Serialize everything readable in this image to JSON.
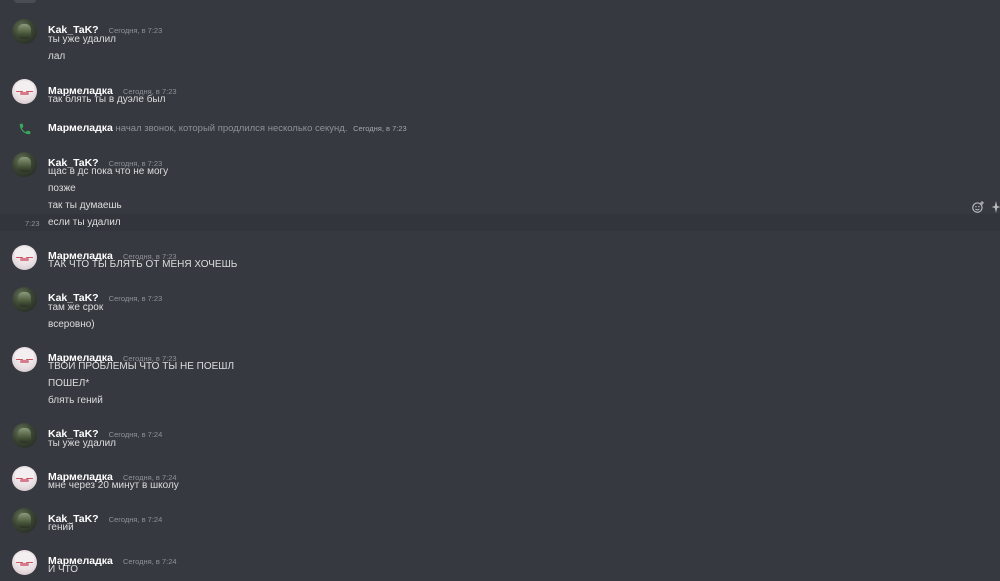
{
  "users": {
    "kak": "Kak_TaK?",
    "marm": "Мармеладка"
  },
  "groups": [
    {
      "author": "Kak_TaK?",
      "time": "Сегодня, в 7:23",
      "messages": [
        "ты уже удалил",
        "лал"
      ]
    },
    {
      "author": "Мармеладка",
      "time": "Сегодня, в 7:23",
      "messages": [
        "так блять ты в дуэле был"
      ]
    },
    {
      "author": "Kak_TaK?",
      "time": "Сегодня, в 7:23",
      "messages": [
        "щас в дс пока что не могу",
        "позже",
        "так ты думаешь",
        "если ты удалил"
      ]
    },
    {
      "author": "Мармеладка",
      "time": "Сегодня, в 7:23",
      "messages": [
        "ТАК ЧТО ТЫ БЛЯТЬ ОТ МЕНЯ ХОЧЕШЬ"
      ]
    },
    {
      "author": "Kak_TaK?",
      "time": "Сегодня, в 7:23",
      "messages": [
        "там же срок",
        "всеровно)"
      ]
    },
    {
      "author": "Мармеладка",
      "time": "Сегодня, в 7:23",
      "messages": [
        "ТВОИ ПРОБЛЕМЫ ЧТО ТЫ НЕ ПОЕШЛ",
        "ПОШЕЛ*",
        "блять гений"
      ]
    },
    {
      "author": "Kak_TaK?",
      "time": "Сегодня, в 7:24",
      "messages": [
        "ты уже удалил"
      ]
    },
    {
      "author": "Мармеладка",
      "time": "Сегодня, в 7:24",
      "messages": [
        "мне через 20 минут в школу"
      ]
    },
    {
      "author": "Kak_TaK?",
      "time": "Сегодня, в 7:24",
      "messages": [
        "гений"
      ]
    },
    {
      "author": "Мармеладка",
      "time": "Сегодня, в 7:24",
      "messages": [
        "И ЧТО"
      ]
    }
  ],
  "call": {
    "author": "Мармеладка",
    "text": "начал звонок, который продлился несколько секунд.",
    "time": "Сегодня, в 7:23"
  },
  "hover_time": "7:23",
  "colors": {
    "background": "#36393f",
    "username": "#ffffff",
    "message": "#dcddde",
    "muted": "#8e9297",
    "call_green": "#3ba55d"
  },
  "icons": {
    "call": "phone-icon",
    "react": "add-reaction-icon",
    "more": "more-icon"
  }
}
